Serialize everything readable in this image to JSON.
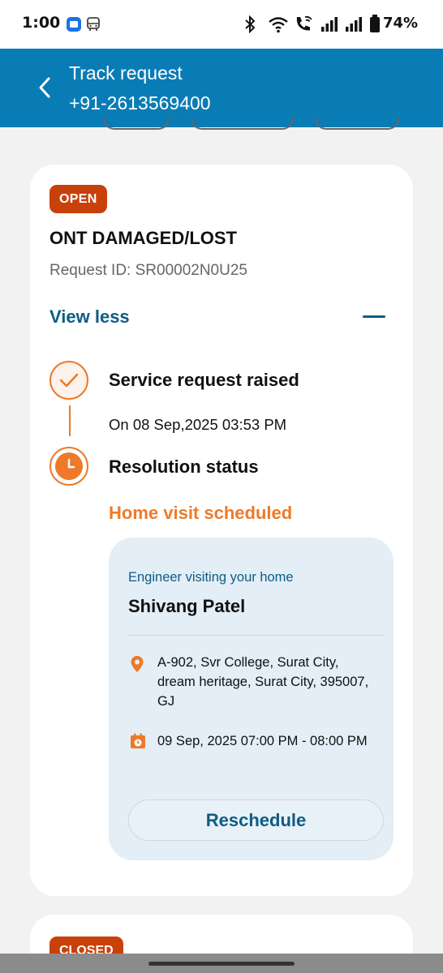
{
  "status_bar": {
    "time": "1:00",
    "battery": "74%",
    "icons": [
      "app-notification-icon",
      "bus-icon",
      "bluetooth-icon",
      "wifi-icon",
      "wifi-calling-icon",
      "signal-icon",
      "signal-icon",
      "battery-icon"
    ]
  },
  "header": {
    "title": "Track request",
    "subtitle": "+91-2613569400",
    "back_icon": "back-arrow-icon",
    "background": "#0a7cb5"
  },
  "request": {
    "status_badge": "OPEN",
    "title": "ONT DAMAGED/LOST",
    "request_id": "Request ID: SR00002N0U25",
    "toggle_label": "View less",
    "toggle_icon": "minus-icon"
  },
  "timeline": {
    "step1": {
      "title": "Service request raised",
      "date": "On 08 Sep,2025 03:53 PM",
      "icon": "check-icon"
    },
    "step2": {
      "title": "Resolution status",
      "status": "Home visit scheduled",
      "icon": "clock-icon"
    }
  },
  "visit": {
    "label": "Engineer visiting your home",
    "engineer": "Shivang Patel",
    "address": "A-902, Svr College, Surat City, dream heritage, Surat City, 395007, GJ",
    "slot": "09 Sep, 2025 07:00 PM - 08:00 PM",
    "button": "Reschedule",
    "address_icon": "location-pin-icon",
    "slot_icon": "calendar-clock-icon"
  },
  "next_request": {
    "status_badge": "CLOSED"
  },
  "colors": {
    "accent_orange": "#ee7a29",
    "badge_red": "#c9410a",
    "link_blue": "#0e5c84",
    "visit_card_bg": "#e3eef6"
  }
}
